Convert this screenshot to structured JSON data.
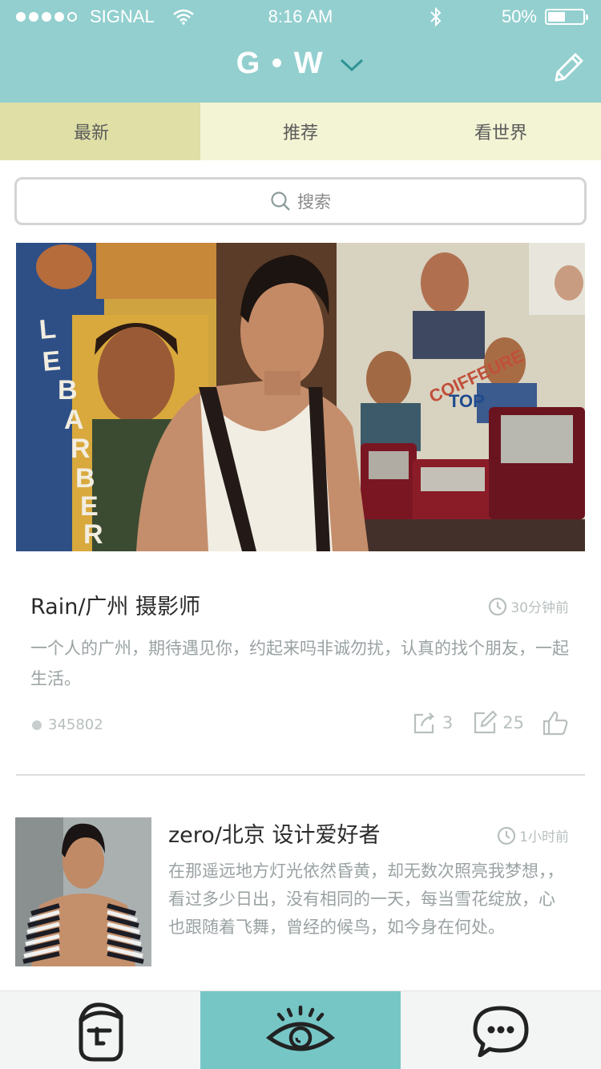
{
  "status_bar": {
    "carrier": "SIGNAL",
    "time": "8:16 AM",
    "battery": "50%",
    "battery_level": 0.5
  },
  "header": {
    "title": "G • W"
  },
  "tabs": [
    {
      "label": "最新",
      "active": true
    },
    {
      "label": "推荐",
      "active": false
    },
    {
      "label": "看世界",
      "active": false
    }
  ],
  "search": {
    "placeholder": "搜索"
  },
  "posts": [
    {
      "title": "Rain/广州 摄影师",
      "time": "30分钟前",
      "description": "一个人的广州，期待遇见你，约起来吗非诚勿扰，认真的找个朋友，一起生活。",
      "views": "345802",
      "shares": "3",
      "comments": "25"
    },
    {
      "title": "zero/北京 设计爱好者",
      "time": "1小时前",
      "description": "在那遥远地方灯光依然昏黄，却无数次照亮我梦想，，看过多少日出，没有相同的一天，每当雪花绽放，心也跟随着飞舞，曾经的候鸟，如今身在何处。"
    }
  ],
  "colors": {
    "header_bg": "#93cfcf",
    "tab_bg": "#f3f4d4",
    "tab_active_bg": "#dfdfa6",
    "bottom_active_bg": "#76c6c6"
  },
  "bottom_nav": [
    {
      "icon": "face-icon",
      "active": false
    },
    {
      "icon": "eye-icon",
      "active": true
    },
    {
      "icon": "chat-icon",
      "active": false
    }
  ]
}
